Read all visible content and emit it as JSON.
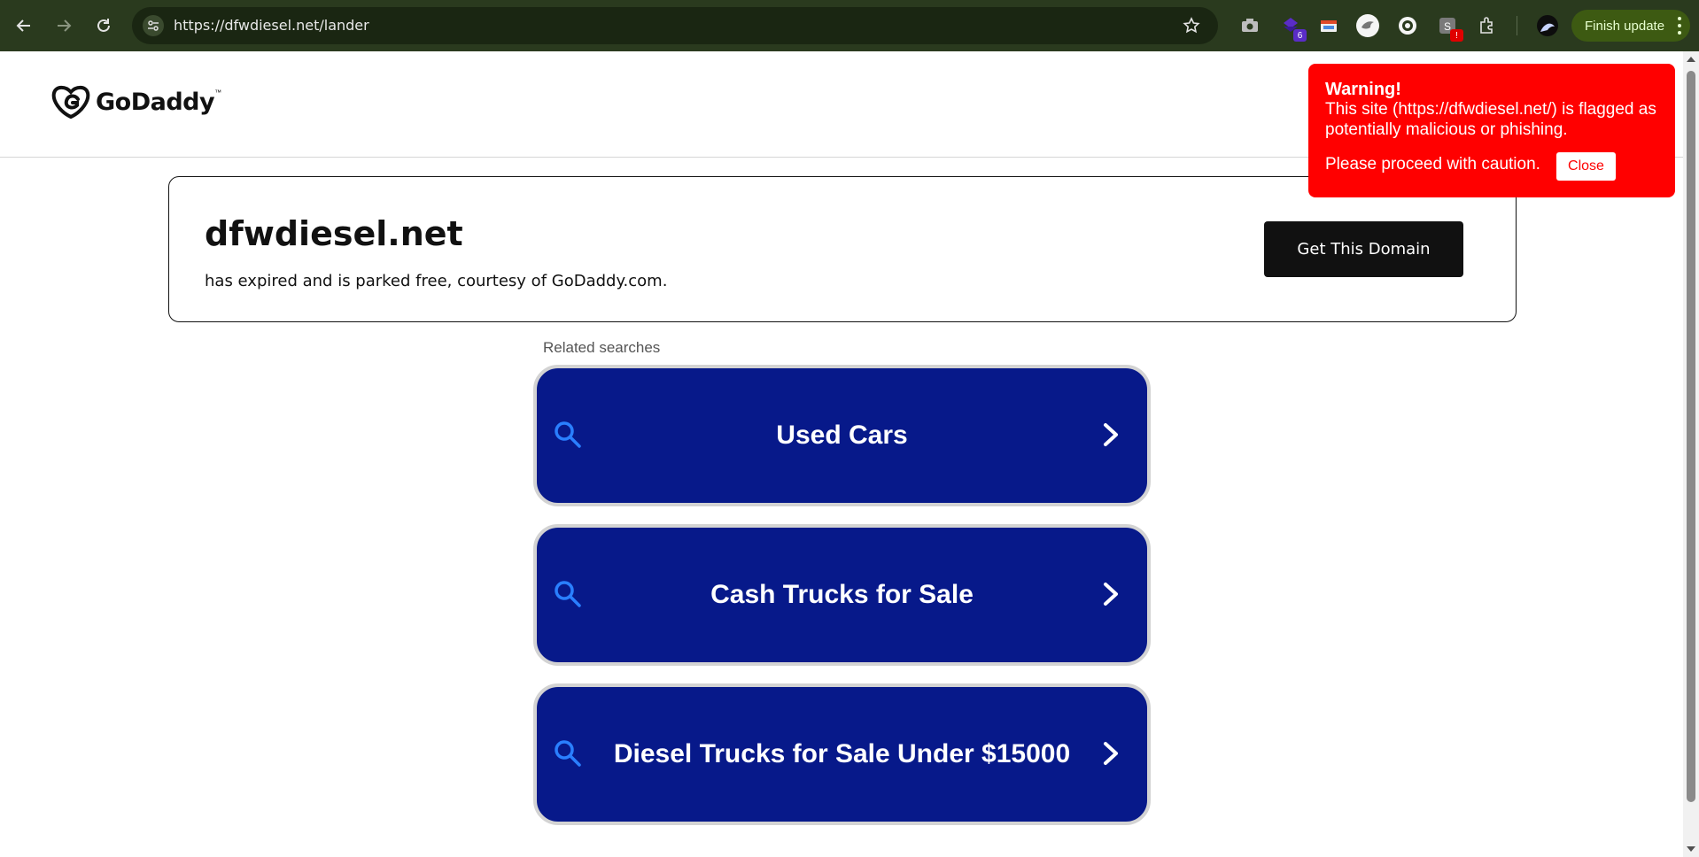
{
  "browser": {
    "url": "https://dfwdiesel.net/lander",
    "back_icon": "arrow-left",
    "forward_icon": "arrow-right",
    "reload_icon": "reload",
    "extensions": [
      {
        "name": "camera-icon"
      },
      {
        "name": "puzzle-purple-icon",
        "badge": "6"
      },
      {
        "name": "window-icon"
      },
      {
        "name": "bird-icon"
      },
      {
        "name": "bot-icon"
      },
      {
        "name": "shield-ext-icon",
        "badge": "!"
      },
      {
        "name": "extensions-icon"
      }
    ],
    "finish_update_label": "Finish update",
    "colors": {
      "toolbar": "#2a3a1e",
      "omnibox": "#1a2612",
      "finish_update": "#3d5a12"
    }
  },
  "header": {
    "logo_text": "GoDaddy",
    "logo_tm": "™"
  },
  "domain_card": {
    "domain": "dfwdiesel.net",
    "subtitle": "has expired and is parked free, courtesy of GoDaddy.com.",
    "cta_label": "Get This Domain"
  },
  "related": {
    "label": "Related searches",
    "items": [
      {
        "label": "Used Cars"
      },
      {
        "label": "Cash Trucks for Sale"
      },
      {
        "label": "Diesel Trucks for Sale Under $15000"
      }
    ],
    "colors": {
      "card_bg": "#07198a",
      "icon": "#2a7fff",
      "border": "#d3d3d3"
    }
  },
  "warning": {
    "title": "Warning!",
    "message": "This site (https://dfwdiesel.net/) is flagged as potentially malicious or phishing.",
    "caution": "Please proceed with caution.",
    "close_label": "Close",
    "color": "#ff0000"
  }
}
